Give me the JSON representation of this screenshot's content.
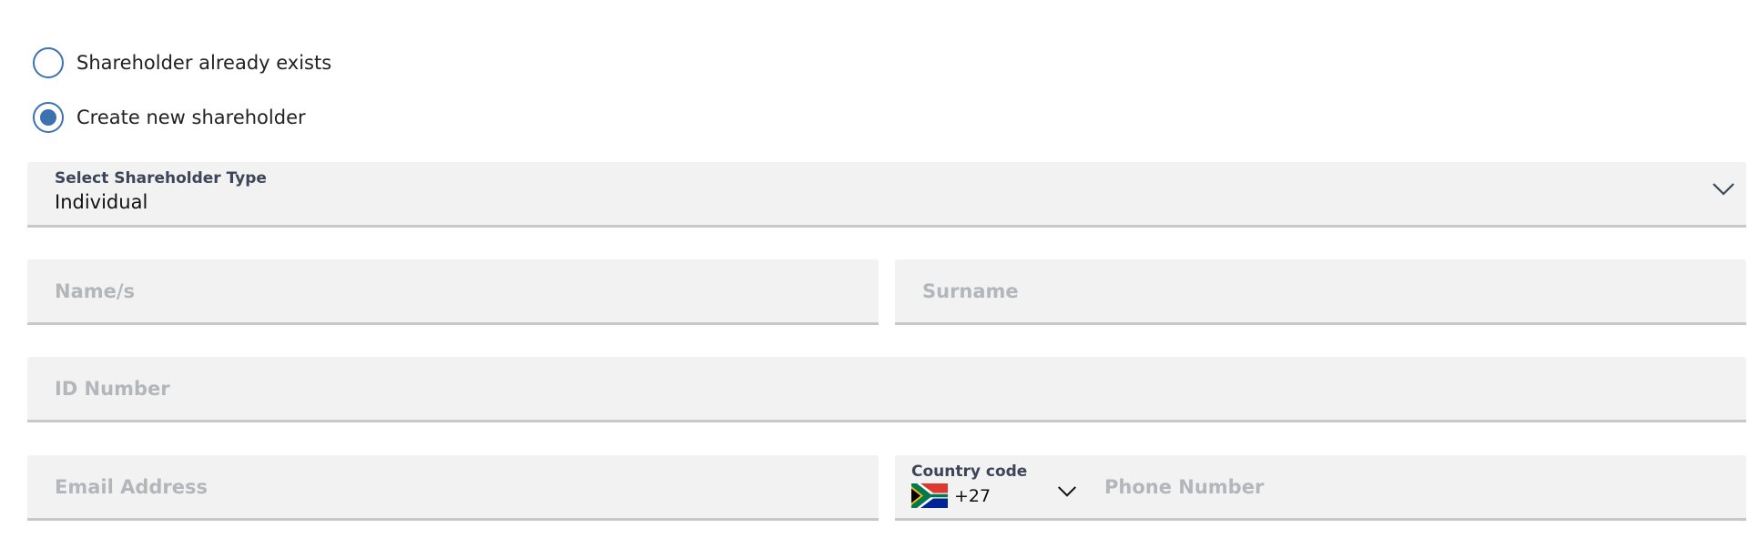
{
  "shareholder_mode": {
    "options": [
      {
        "label": "Shareholder already exists",
        "selected": false
      },
      {
        "label": "Create new shareholder",
        "selected": true
      }
    ]
  },
  "shareholder_type": {
    "label": "Select Shareholder Type",
    "value": "Individual"
  },
  "fields": {
    "names_placeholder": "Name/s",
    "surname_placeholder": "Surname",
    "id_number_placeholder": "ID Number",
    "email_placeholder": "Email Address",
    "phone_placeholder": "Phone Number"
  },
  "country_code": {
    "label": "Country code",
    "value": "+27",
    "flag_icon": "south-africa-flag-icon"
  },
  "colors": {
    "accent": "#3d72b0",
    "field_bg": "#f2f2f2",
    "field_border": "#c8c8c8",
    "placeholder": "#b3b7bc",
    "label": "#3c4658"
  }
}
